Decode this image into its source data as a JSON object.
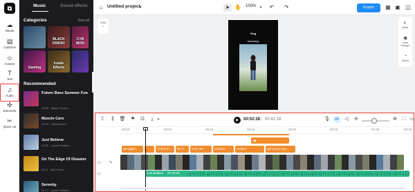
{
  "rail": {
    "logo": "⧉",
    "items": [
      {
        "label": "Media",
        "icon": "cloud-upload-icon",
        "glyph": "☁"
      },
      {
        "label": "Captions",
        "icon": "captions-icon",
        "glyph": "▤"
      },
      {
        "label": "Avatars",
        "icon": "avatar-icon",
        "glyph": "☺"
      },
      {
        "label": "Text",
        "icon": "text-icon",
        "glyph": "T"
      },
      {
        "label": "Audio",
        "icon": "music-note-icon",
        "glyph": "♫"
      },
      {
        "label": "Elements",
        "icon": "elements-icon",
        "glyph": "✣"
      },
      {
        "label": "Quick cut",
        "icon": "scissors-icon",
        "glyph": "✂"
      }
    ]
  },
  "panel": {
    "tabs": {
      "music": "Music",
      "sound_effects": "Sound effects"
    },
    "categories_title": "Categories",
    "view_all": "View all",
    "categories": [
      {
        "label": "",
        "colors": [
          "#2a4c6b",
          "#6d8aa0"
        ]
      },
      {
        "label": "BLACK FRIDAY",
        "colors": [
          "#3a1c1c",
          "#8a3c3c"
        ]
      },
      {
        "label": "CYB MON",
        "colors": [
          "#5a1c40",
          "#b8336a"
        ]
      },
      {
        "label": "Gaming",
        "colors": [
          "#3a1648",
          "#c2327f"
        ]
      },
      {
        "label": "Inside Effects",
        "colors": [
          "#3b2d18",
          "#8c6a2c"
        ]
      },
      {
        "label": "",
        "colors": [
          "#2a2a6a",
          "#6a3ab0"
        ]
      }
    ],
    "recommended_title": "Recommended",
    "tracks": [
      {
        "title": "Future Bass Summer Fun",
        "meta": "00:59 · Mayur Suresh...",
        "colors": [
          "#7a2a8a",
          "#c03a5a"
        ]
      },
      {
        "title": "Muscle Cars",
        "meta": "01:04 · Openmoood",
        "colors": [
          "#2c2c2c",
          "#7a4a2a"
        ]
      },
      {
        "title": "Just Believe",
        "meta": "02:39 · Lynne Publishi...",
        "colors": [
          "#5a7aa8",
          "#c0d0e0"
        ]
      },
      {
        "title": "On The Edge Of Disaster",
        "meta": "02:11 · Neil Cross",
        "colors": [
          "#c08a1a",
          "#f0c040"
        ]
      },
      {
        "title": "Serenity",
        "meta": "01:17 · Lynne Publishi...",
        "colors": [
          "#2a5a7a",
          "#7ab0c8"
        ]
      }
    ]
  },
  "topbar": {
    "project_title": "Untitled project",
    "zoom": "100%",
    "export_label": "Export"
  },
  "canvas": {
    "ratio": "9:16",
    "video_text_top": "Vlog",
    "video_text_sub": "#shortvlog",
    "right_tools": [
      {
        "label": "Basic",
        "icon": "basic-adjust-icon",
        "glyph": "◐"
      },
      {
        "label": "Voice changer",
        "icon": "voice-changer-icon",
        "glyph": "◉"
      },
      {
        "label": "Speed",
        "icon": "speed-icon",
        "glyph": "◔"
      }
    ]
  },
  "timeline": {
    "current_time": "00:02:28",
    "separator": "|",
    "total_time": "00:41:28",
    "ruler": [
      "00:00",
      "00:05",
      "00:10",
      "00:15",
      "00:20",
      "00:25",
      "00:30",
      "00:35"
    ],
    "sticker_clip": "",
    "text_clips": [
      "Strugglin...",
      "",
      "Check th",
      "Its m",
      "even wh",
      "And the",
      "Perfect",
      "get yours now"
    ],
    "audio_label": "Just Believe",
    "audio_duration": "02:39:00"
  }
}
